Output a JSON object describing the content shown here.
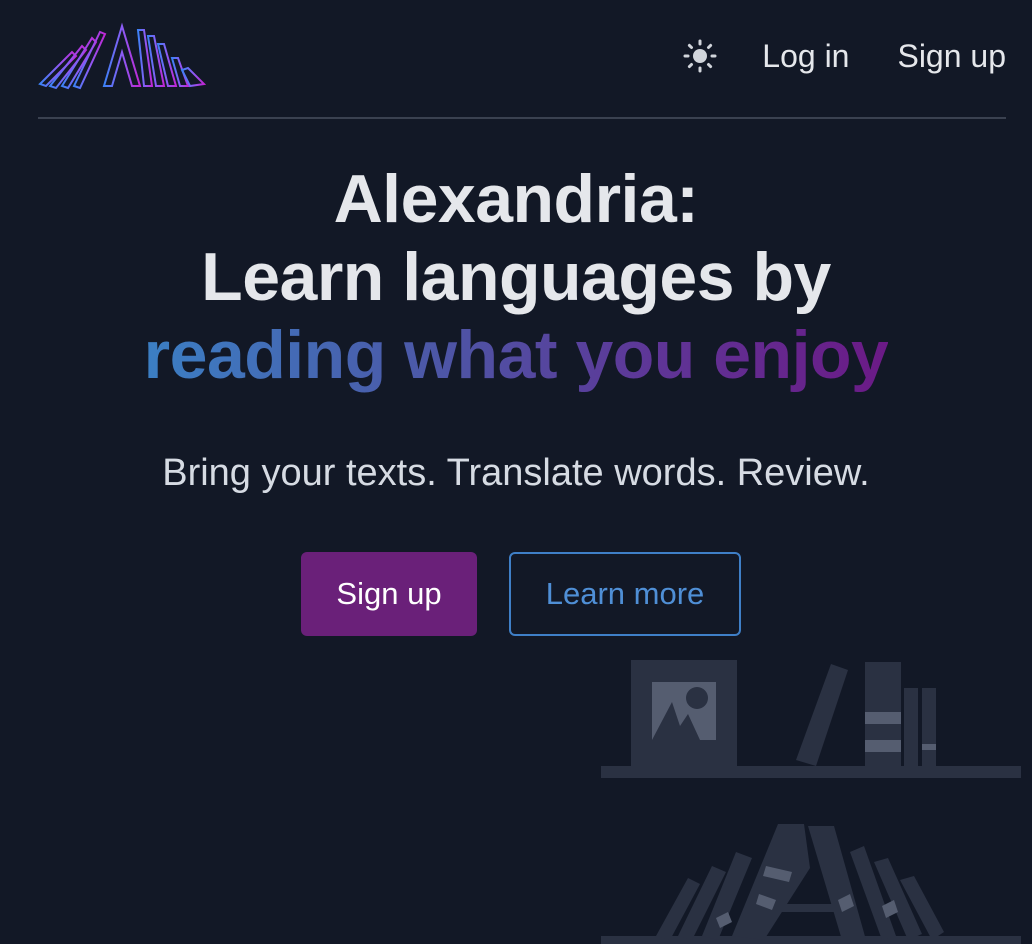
{
  "header": {
    "logo_icon": "alexandria-logo-icon",
    "theme_toggle_icon": "sun-icon",
    "login_label": "Log in",
    "signup_label": "Sign up"
  },
  "hero": {
    "title_line1": "Alexandria:",
    "title_line2": "Learn languages by",
    "title_line3": "reading what you enjoy",
    "tagline": "Bring your texts. Translate words. Review."
  },
  "cta": {
    "primary_label": "Sign up",
    "secondary_label": "Learn more"
  },
  "illustration": {
    "icon": "bookshelf-illustration"
  },
  "colors": {
    "background": "#121826",
    "primary_button": "#6a2079",
    "outline_button": "#3f7fc7",
    "gradient_start": "#3b7fc4",
    "gradient_end": "#6b1a86"
  }
}
